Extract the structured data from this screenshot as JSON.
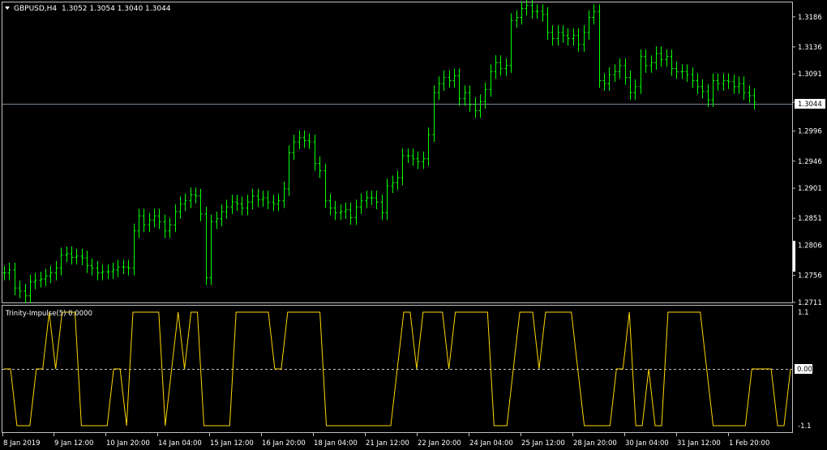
{
  "main_panel": {
    "symbol_timeframe": "GBPUSD,H4",
    "ohlc": "1.3052 1.3054 1.3040 1.3044",
    "header_icon": "triangle-down-icon",
    "price_ticks": [
      "1.3186",
      "1.3136",
      "1.3091",
      "1.3044",
      "1.2996",
      "1.2946",
      "1.2901",
      "1.2851",
      "1.2806",
      "1.2756",
      "1.2711"
    ],
    "current_price": "1.3044",
    "bar_color": "#00ff00",
    "current_line_color": "#778899"
  },
  "indicator_panel": {
    "title": "Trinity-Impulse(5) 0.0000",
    "ticks": [
      "1.1",
      "0.00",
      "-1.1"
    ],
    "current_value": "0.00",
    "line_color": "#ffd700"
  },
  "time_axis": {
    "labels": [
      "8 Jan 2019",
      "9 Jan 12:00",
      "10 Jan 20:00",
      "14 Jan 04:00",
      "15 Jan 12:00",
      "16 Jan 20:00",
      "18 Jan 04:00",
      "21 Jan 12:00",
      "22 Jan 20:00",
      "24 Jan 04:00",
      "25 Jan 12:00",
      "28 Jan 20:00",
      "30 Jan 04:00",
      "31 Jan 12:00",
      "1 Feb 20:00"
    ]
  },
  "chart_data": [
    {
      "type": "line",
      "title": "GBPUSD,H4",
      "series": [
        {
          "name": "GBPUSD",
          "x_start": "8 Jan 2019",
          "step_hours": 4,
          "values": [
            1.276,
            1.2765,
            1.2735,
            1.273,
            1.2722,
            1.2745,
            1.2748,
            1.275,
            1.2755,
            1.276,
            1.2768,
            1.279,
            1.2792,
            1.2786,
            1.2788,
            1.2785,
            1.2772,
            1.2768,
            1.276,
            1.2762,
            1.2762,
            1.2765,
            1.277,
            1.277,
            1.2768,
            1.283,
            1.2855,
            1.284,
            1.2848,
            1.2855,
            1.2845,
            1.283,
            1.284,
            1.2862,
            1.2875,
            1.288,
            1.289,
            1.2888,
            1.2858,
            1.2752,
            1.2845,
            1.285,
            1.2862,
            1.287,
            1.2878,
            1.2875,
            1.2868,
            1.2878,
            1.2888,
            1.2882,
            1.2885,
            1.2878,
            1.2875,
            1.288,
            1.29,
            1.296,
            1.2978,
            1.2985,
            1.298,
            1.2978,
            1.2942,
            1.293,
            1.288,
            1.2868,
            1.286,
            1.2862,
            1.2865,
            1.2852,
            1.287,
            1.288,
            1.2885,
            1.2885,
            1.2878,
            1.286,
            1.2905,
            1.291,
            1.2918,
            1.2955,
            1.2955,
            1.295,
            1.2945,
            1.295,
            1.299,
            1.306,
            1.3075,
            1.3085,
            1.308,
            1.3088,
            1.305,
            1.306,
            1.304,
            1.303,
            1.3045,
            1.3065,
            1.3095,
            1.311,
            1.31,
            1.3105,
            1.318,
            1.3185,
            1.32,
            1.3205,
            1.3195,
            1.3195,
            1.319,
            1.316,
            1.315,
            1.316,
            1.3155,
            1.315,
            1.3155,
            1.314,
            1.316,
            1.3185,
            1.3195,
            1.308,
            1.3075,
            1.309,
            1.3095,
            1.3105,
            1.3085,
            1.306,
            1.307,
            1.312,
            1.3105,
            1.311,
            1.3125,
            1.3115,
            1.312,
            1.31,
            1.3095,
            1.3095,
            1.309,
            1.308,
            1.307,
            1.3062,
            1.3048,
            1.308,
            1.3075,
            1.308,
            1.3078,
            1.307,
            1.3075,
            1.306,
            1.3055,
            1.3044
          ]
        }
      ],
      "ylim": [
        1.2711,
        1.321
      ]
    },
    {
      "type": "line",
      "title": "Trinity-Impulse(5) 0.0000",
      "series": [
        {
          "name": "Trinity-Impulse(5)",
          "values": [
            0,
            0,
            -1.1,
            -1.1,
            -1.1,
            0,
            0,
            1.1,
            0,
            1.1,
            1.1,
            1.1,
            -1.1,
            -1.1,
            -1.1,
            -1.1,
            -1.1,
            0,
            0,
            -1.1,
            1.1,
            1.1,
            1.1,
            1.1,
            1.1,
            -1.1,
            0,
            1.1,
            0,
            1.1,
            1.1,
            -1.1,
            -1.1,
            -1.1,
            -1.1,
            -1.1,
            1.1,
            1.1,
            1.1,
            1.1,
            1.1,
            1.1,
            0,
            0,
            1.1,
            1.1,
            1.1,
            1.1,
            1.1,
            1.1,
            -1.1,
            -1.1,
            -1.1,
            -1.1,
            -1.1,
            -1.1,
            -1.1,
            -1.1,
            -1.1,
            -1.1,
            -1.1,
            0,
            1.1,
            1.1,
            0,
            1.1,
            1.1,
            1.1,
            1.1,
            0,
            1.1,
            1.1,
            1.1,
            1.1,
            1.1,
            1.1,
            -1.1,
            -1.1,
            -1.1,
            0,
            1.1,
            1.1,
            1.1,
            0,
            1.1,
            1.1,
            1.1,
            1.1,
            1.1,
            0,
            -1.1,
            -1.1,
            -1.1,
            -1.1,
            -1.1,
            0,
            0,
            1.1,
            -1.1,
            -1.1,
            0,
            -1.1,
            -1.1,
            1.1,
            1.1,
            1.1,
            1.1,
            1.1,
            1.1,
            0,
            -1.1,
            -1.1,
            -1.1,
            -1.1,
            -1.1,
            -1.1,
            0,
            0,
            0,
            0,
            -1.1,
            -1.1,
            0
          ]
        }
      ],
      "ylim": [
        -1.1,
        1.1
      ]
    }
  ]
}
